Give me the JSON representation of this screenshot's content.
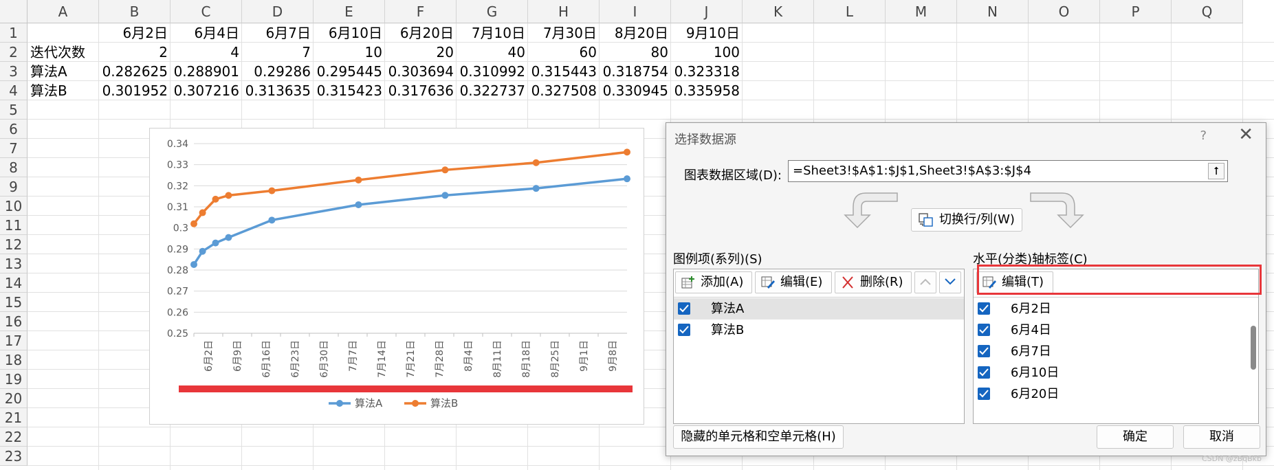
{
  "sheet": {
    "col_letters": [
      "A",
      "B",
      "C",
      "D",
      "E",
      "F",
      "G",
      "H",
      "I",
      "J",
      "K",
      "L",
      "M",
      "N",
      "O",
      "P",
      "Q"
    ],
    "row_numbers": [
      "1",
      "2",
      "3",
      "4",
      "5",
      "6",
      "7",
      "8",
      "9",
      "10",
      "11",
      "12",
      "13",
      "14",
      "15",
      "16",
      "17",
      "18",
      "19",
      "20",
      "21",
      "22",
      "23"
    ],
    "cells": {
      "r1": [
        "",
        "6月2日",
        "6月4日",
        "6月7日",
        "6月10日",
        "6月20日",
        "7月10日",
        "7月30日",
        "8月20日",
        "9月10日"
      ],
      "r2": [
        "迭代次数",
        "2",
        "4",
        "7",
        "10",
        "20",
        "40",
        "60",
        "80",
        "100"
      ],
      "r3": [
        "算法A",
        "0.282625",
        "0.288901",
        "0.29286",
        "0.295445",
        "0.303694",
        "0.310992",
        "0.315443",
        "0.318754",
        "0.323318"
      ],
      "r4": [
        "算法B",
        "0.301952",
        "0.307216",
        "0.313635",
        "0.315423",
        "0.317636",
        "0.322737",
        "0.327508",
        "0.330945",
        "0.335958"
      ]
    }
  },
  "chart_data": {
    "type": "line",
    "x_dates": [
      "2024-06-02",
      "2024-06-04",
      "2024-06-07",
      "2024-06-10",
      "2024-06-20",
      "2024-07-10",
      "2024-07-30",
      "2024-08-20",
      "2024-09-10"
    ],
    "x_tick_labels": [
      "6月2日",
      "6月9日",
      "6月16日",
      "6月23日",
      "6月30日",
      "7月7日",
      "7月14日",
      "7月21日",
      "7月28日",
      "8月4日",
      "8月11日",
      "8月18日",
      "8月25日",
      "9月1日",
      "9月8日"
    ],
    "series": [
      {
        "name": "算法A",
        "color": "#5b9bd5",
        "values": [
          0.282625,
          0.288901,
          0.29286,
          0.295445,
          0.303694,
          0.310992,
          0.315443,
          0.318754,
          0.323318
        ]
      },
      {
        "name": "算法B",
        "color": "#ed7d31",
        "values": [
          0.301952,
          0.307216,
          0.313635,
          0.315423,
          0.317636,
          0.322737,
          0.327508,
          0.330945,
          0.335958
        ]
      }
    ],
    "y_ticks": [
      "0.34",
      "0.33",
      "0.32",
      "0.31",
      "0.3",
      "0.29",
      "0.28",
      "0.27",
      "0.26",
      "0.25"
    ],
    "ylim": [
      0.25,
      0.34
    ],
    "grid": true,
    "legend_position": "bottom",
    "annotation_color": "#e8363a"
  },
  "dialog": {
    "title": "选择数据源",
    "help": "?",
    "close": "✕",
    "range_label": "图表数据区域(D):",
    "range_value": "=Sheet3!$A$1:$J$1,Sheet3!$A$3:$J$4",
    "switch_label": "切换行/列(W)",
    "legend_section_label": "图例项(系列)(S)",
    "axis_section_label": "水平(分类)轴标签(C)",
    "add_label": "添加(A)",
    "edit_label": "编辑(E)",
    "delete_label": "删除(R)",
    "axis_edit_label": "编辑(T)",
    "series_items": [
      "算法A",
      "算法B"
    ],
    "axis_items": [
      "6月2日",
      "6月4日",
      "6月7日",
      "6月10日",
      "6月20日"
    ],
    "hidden_cells_label": "隐藏的单元格和空单元格(H)",
    "ok_label": "确定",
    "cancel_label": "取消",
    "accent_color": "#1565c0",
    "highlight_color": "#e8363a"
  },
  "watermark": "CSDN @zBqBkb"
}
